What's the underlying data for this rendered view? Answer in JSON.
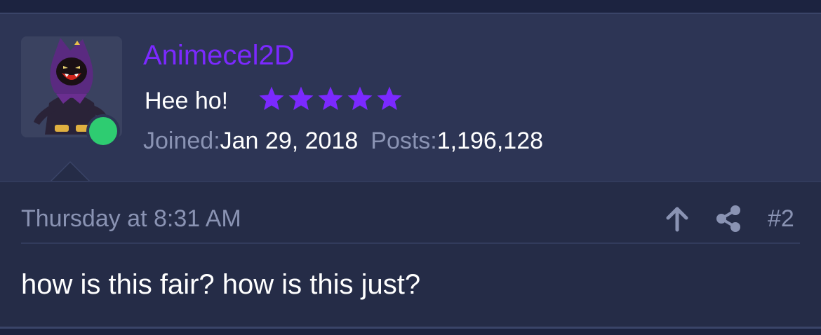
{
  "post": {
    "username": "Animecel2D",
    "user_title": "Hee ho!",
    "rating_stars": 5,
    "joined_label": "Joined:",
    "joined_value": "Jan 29, 2018",
    "posts_label": "Posts:",
    "posts_value": "1,196,128",
    "timestamp": "Thursday at 8:31 AM",
    "post_number": "#2",
    "message": "how is this fair? how is this just?"
  },
  "icons": {
    "upvote": "arrow-up-icon",
    "share": "share-icon",
    "star": "star-icon"
  },
  "colors": {
    "username": "#7b29ff",
    "stars": "#7b29ff",
    "online": "#2ecc71",
    "header_bg": "#2d3555",
    "body_bg": "#252c47"
  }
}
